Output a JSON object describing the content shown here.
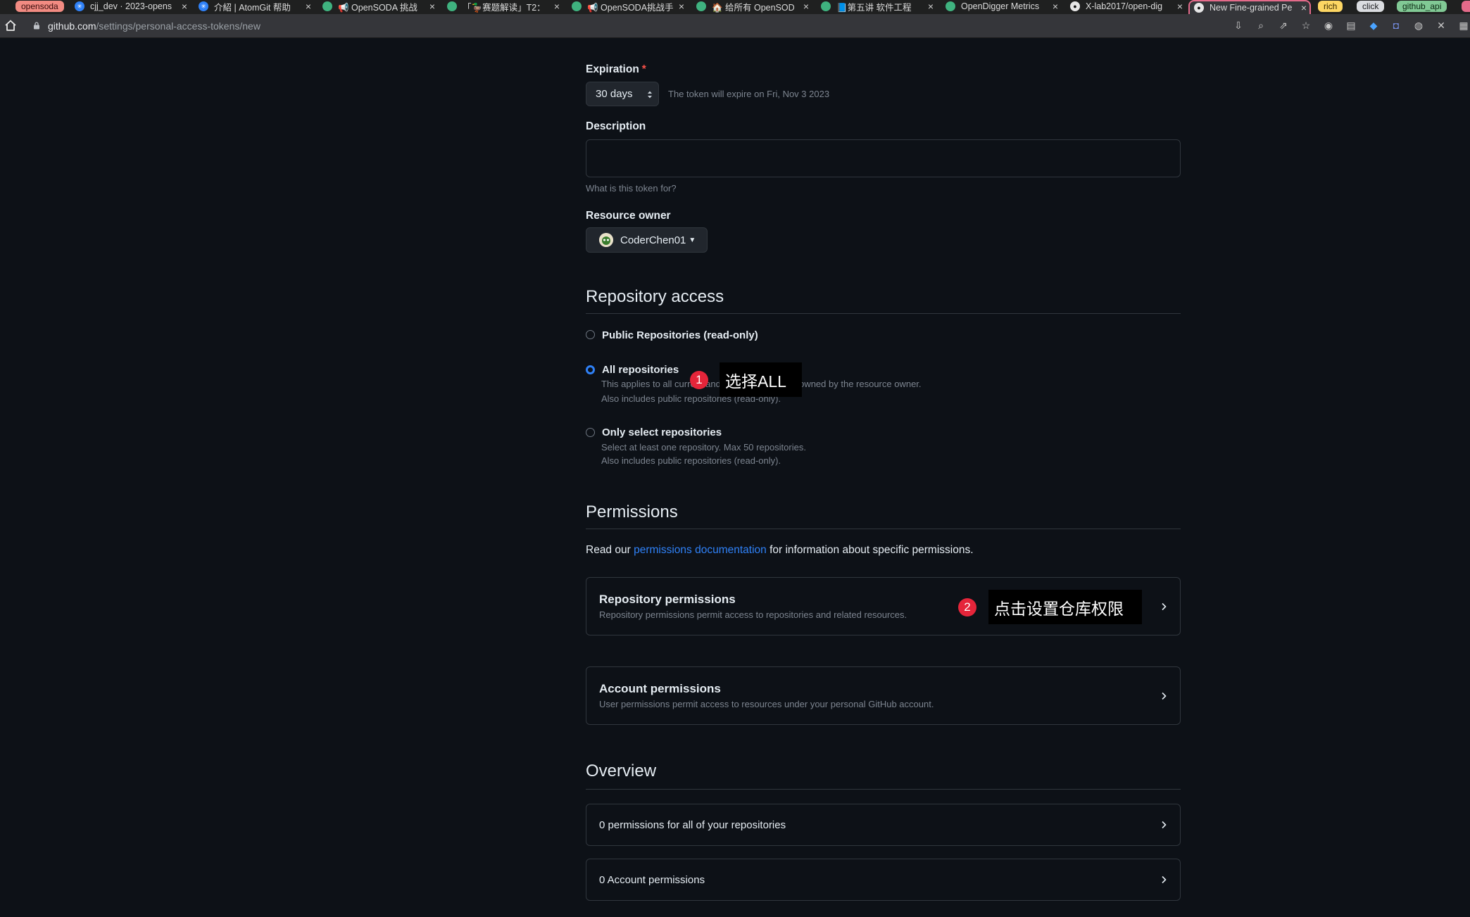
{
  "browser": {
    "tab_groups": [
      {
        "label": "opensoda",
        "bg": "#f28b82",
        "fg": "#3a0d0d"
      },
      {
        "label": "rich",
        "bg": "#fdd663",
        "fg": "#3a2a00"
      },
      {
        "label": "click",
        "bg": "#dadce0",
        "fg": "#202124"
      },
      {
        "label": "github_api",
        "bg": "#81c995",
        "fg": "#0d2b14"
      }
    ],
    "tabs": [
      {
        "title": "cjj_dev · 2023-opens",
        "icon": "atomgit-icon"
      },
      {
        "title": "介紹 | AtomGit 帮助",
        "icon": "atomgit-icon"
      },
      {
        "title": "📢 OpenSODA 挑战",
        "icon": "opensoda-icon"
      },
      {
        "title": "「🦆赛题解读」T2：",
        "icon": "opensoda-icon"
      },
      {
        "title": "📢 OpenSODA挑战手",
        "icon": "opensoda-icon"
      },
      {
        "title": "🏠 给所有 OpenSOD",
        "icon": "opensoda-icon"
      },
      {
        "title": "📘第五讲 软件工程",
        "icon": "opensoda-icon"
      },
      {
        "title": "OpenDigger Metrics",
        "icon": "opensoda-icon"
      },
      {
        "title": "X-lab2017/open-dig",
        "icon": "github-icon"
      },
      {
        "title": "New Fine-grained Pe",
        "icon": "github-icon"
      }
    ],
    "url_host": "github.com",
    "url_path": "/settings/personal-access-tokens/new"
  },
  "form": {
    "expiration_label": "Expiration",
    "required_mark": "*",
    "expiration_value": "30 days",
    "expiration_note": "The token will expire on Fri, Nov 3 2023",
    "description_label": "Description",
    "description_value": "",
    "description_hint": "What is this token for?",
    "resource_owner_label": "Resource owner",
    "resource_owner_value": "CoderChen01"
  },
  "repository_access": {
    "heading": "Repository access",
    "options": [
      {
        "label": "Public Repositories (read-only)",
        "checked": false,
        "desc1": "",
        "desc2": ""
      },
      {
        "label": "All repositories",
        "checked": true,
        "desc1": "This applies to all current and future repositories owned by the resource owner.",
        "desc2": "Also includes public repositories (read-only)."
      },
      {
        "label": "Only select repositories",
        "checked": false,
        "desc1": "Select at least one repository. Max 50 repositories.",
        "desc2": "Also includes public repositories (read-only)."
      }
    ]
  },
  "permissions": {
    "heading": "Permissions",
    "intro_before": "Read our ",
    "intro_link": "permissions documentation",
    "intro_after": " for information about specific permissions.",
    "repo_title": "Repository permissions",
    "repo_desc": "Repository permissions permit access to repositories and related resources.",
    "account_title": "Account permissions",
    "account_desc": "User permissions permit access to resources under your personal GitHub account."
  },
  "overview": {
    "heading": "Overview",
    "rows": [
      "0 permissions for all of your repositories",
      "0 Account permissions"
    ]
  },
  "annotations": [
    {
      "number": "1",
      "text": "选择ALL"
    },
    {
      "number": "2",
      "text": "点击设置仓库权限"
    }
  ]
}
